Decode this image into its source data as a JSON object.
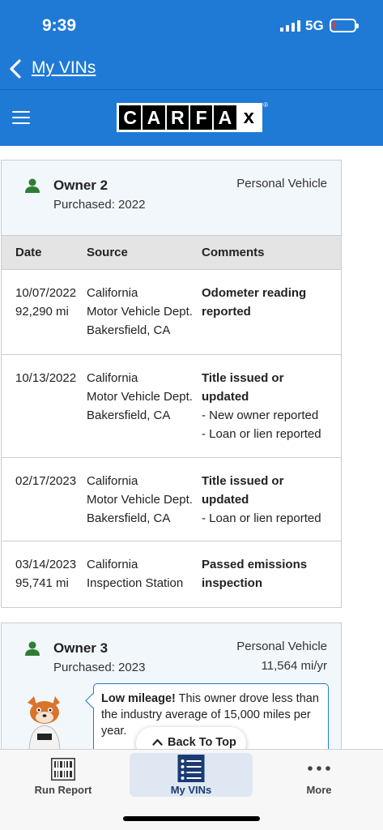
{
  "status_bar": {
    "time": "9:39",
    "network": "5G"
  },
  "nav": {
    "back_label": "My VINs"
  },
  "brand": {
    "letters": [
      "C",
      "A",
      "R",
      "F",
      "A",
      "x"
    ],
    "registered": "®"
  },
  "owners": [
    {
      "title": "Owner 2",
      "purchased": "Purchased: 2022",
      "type": "Personal Vehicle",
      "table": {
        "headers": {
          "date": "Date",
          "source": "Source",
          "comments": "Comments"
        },
        "rows": [
          {
            "date": "10/07/2022",
            "mileage": "92,290 mi",
            "source": [
              "California",
              "Motor Vehicle Dept.",
              "Bakersfield, CA"
            ],
            "comment_title": [
              "Odometer reading",
              "reported"
            ],
            "details": []
          },
          {
            "date": "10/13/2022",
            "mileage": "",
            "source": [
              "California",
              "Motor Vehicle Dept.",
              "Bakersfield, CA"
            ],
            "comment_title": [
              "Title issued or",
              "updated"
            ],
            "details": [
              "- New owner reported",
              "- Loan or lien reported"
            ]
          },
          {
            "date": "02/17/2023",
            "mileage": "",
            "source": [
              "California",
              "Motor Vehicle Dept.",
              "Bakersfield, CA"
            ],
            "comment_title": [
              "Title issued or",
              "updated"
            ],
            "details": [
              "- Loan or lien reported"
            ]
          },
          {
            "date": "03/14/2023",
            "mileage": "95,741 mi",
            "source": [
              "California",
              "Inspection Station"
            ],
            "comment_title": [
              "Passed emissions",
              "inspection"
            ],
            "details": []
          }
        ]
      }
    },
    {
      "title": "Owner 3",
      "purchased": "Purchased: 2023",
      "type": "Personal Vehicle",
      "mileage_rate": "11,564 mi/yr",
      "bubble": {
        "bold": "Low mileage!",
        "text": " This owner drove less than the industry average of 15,000 miles per year."
      }
    }
  ],
  "back_to_top": "Back To Top",
  "tabs": [
    {
      "label": "Run Report",
      "icon": "barcode-icon",
      "active": false
    },
    {
      "label": "My VINs",
      "icon": "list-icon",
      "active": true
    },
    {
      "label": "More",
      "icon": "more-icon",
      "active": false
    }
  ],
  "colors": {
    "primary": "#1f7ad6",
    "owner_icon": "#2e7d32",
    "tab_active_bg": "#dfe8f2"
  }
}
